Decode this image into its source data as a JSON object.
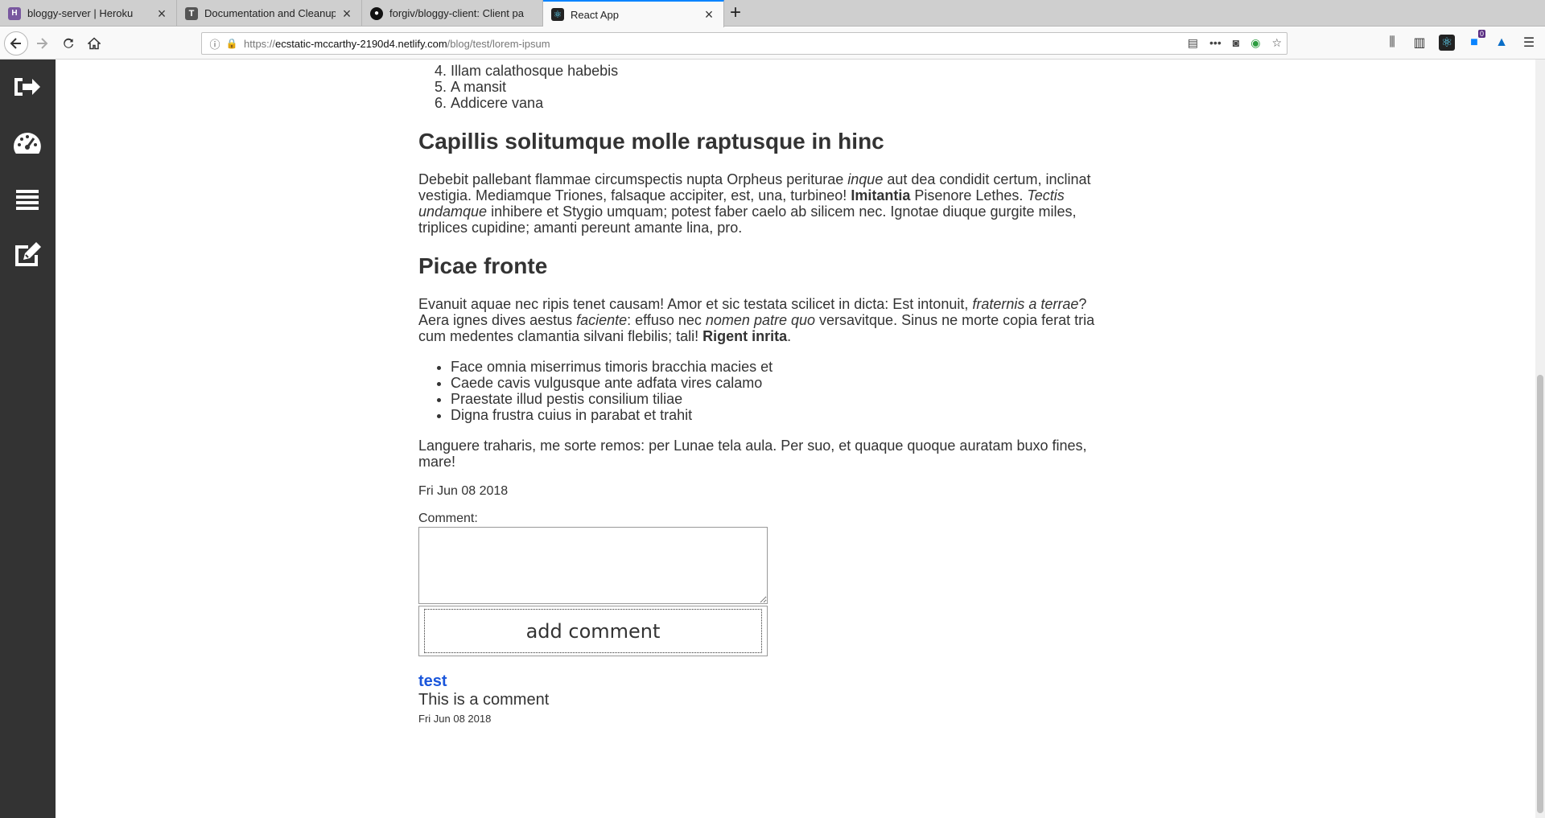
{
  "browser": {
    "tabs": [
      {
        "title": "bloggy-server | Heroku",
        "favicon": "heroku-icon",
        "color": "#79589f"
      },
      {
        "title": "Documentation and Cleanup",
        "favicon": "trello-icon",
        "color": "#555555"
      },
      {
        "title": "forgiv/bloggy-client: Client pa",
        "favicon": "github-icon",
        "color": "#111111"
      },
      {
        "title": "React App",
        "favicon": "react-icon",
        "color": "#61dafb"
      }
    ],
    "new_tab": "+",
    "url_domain": "ecstatic-mccarthy-2190d4.netlify.com",
    "url_prefix": "https://",
    "url_path": "/blog/test/lorem-ipsum",
    "extension_badge": "0"
  },
  "sidebar": {
    "items": [
      {
        "icon": "sign-out-icon"
      },
      {
        "icon": "dashboard-icon"
      },
      {
        "icon": "list-icon"
      },
      {
        "icon": "edit-icon"
      }
    ]
  },
  "post": {
    "ordered_list": [
      "Illam calathosque habebis",
      "A mansit",
      "Addicere vana"
    ],
    "ordered_list_start": 4,
    "heading1": "Capillis solitumque molle raptusque in hinc",
    "para1": {
      "a": "Debebit pallebant flammae circumspectis nupta Orpheus periturae ",
      "a_em": "inque",
      "b": " aut dea condidit certum, inclinat vestigia. Mediamque Triones, falsaque accipiter, est, una, turbineo! ",
      "b_strong": "Imitantia",
      "c": " Pisenore Lethes. ",
      "c_em": "Tectis undamque",
      "d": " inhibere et Stygio umquam; potest faber caelo ab silicem nec. Ignotae diuque gurgite miles, triplices cupidine; amanti pereunt amante lina, pro."
    },
    "heading2": "Picae fronte",
    "para2": {
      "a": "Evanuit aquae nec ripis tenet causam! Amor et sic testata scilicet in dicta: Est intonuit, ",
      "a_em": "fraternis a terrae",
      "b": "? Aera ignes dives aestus ",
      "b_em": "faciente",
      "c": ": effuso nec ",
      "c_em": "nomen patre quo",
      "d": " versavitque. Sinus ne morte copia ferat tria cum medentes clamantia silvani flebilis; tali! ",
      "d_strong": "Rigent inrita",
      "e": "."
    },
    "bullet_list": [
      "Face omnia miserrimus timoris bracchia macies et",
      "Caede cavis vulgusque ante adfata vires calamo",
      "Praestate illud pestis consilium tiliae",
      "Digna frustra cuius in parabat et trahit"
    ],
    "para3": "Languere traharis, me sorte remos: per Lunae tela aula. Per suo, et quaque quoque auratam buxo fines, mare!",
    "date": "Fri Jun 08 2018"
  },
  "comment_form": {
    "label": "Comment:",
    "value": "",
    "button": "add comment"
  },
  "comments": [
    {
      "author": "test",
      "text": "This is a comment",
      "date": "Fri Jun 08 2018"
    }
  ]
}
